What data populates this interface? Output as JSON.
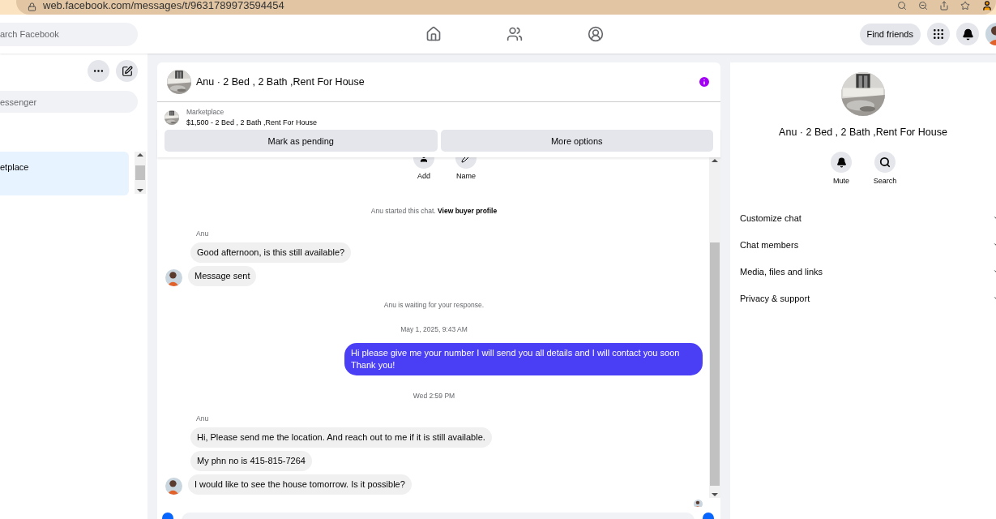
{
  "browser": {
    "url": "web.facebook.com/messages/t/9631789973594454"
  },
  "topbar": {
    "search_placeholder": "arch Facebook",
    "find_friends": "Find friends"
  },
  "sidebar": {
    "search_placeholder": "essenger",
    "items": [
      {
        "label": "etplace",
        "selected": true
      }
    ]
  },
  "chat": {
    "title": "Anu · 2 Bed , 2 Bath ,Rent For House",
    "listing": {
      "source": "Marketplace",
      "summary": "$1,500 - 2 Bed , 2 Bath ,Rent For House"
    },
    "actions": [
      "Mark as pending",
      "More options"
    ],
    "quick_actions": [
      "Add",
      "Name"
    ],
    "messages": [
      {
        "kind": "notice",
        "text": "Anu started this chat.",
        "link": "View buyer profile"
      },
      {
        "kind": "sender",
        "text": "Anu"
      },
      {
        "kind": "incoming",
        "text": "Good afternoon, is this still available?",
        "avatar": false
      },
      {
        "kind": "incoming",
        "text": "Message sent",
        "avatar": true
      },
      {
        "kind": "notice",
        "text": "Anu is waiting for your response."
      },
      {
        "kind": "time",
        "text": "May 1, 2025, 9:43 AM"
      },
      {
        "kind": "outgoing",
        "text": "Hi please give me your number I will send you all details and I will contact you soon Thank you!"
      },
      {
        "kind": "time",
        "text": "Wed 2:59 PM"
      },
      {
        "kind": "sender",
        "text": "Anu"
      },
      {
        "kind": "incoming",
        "text": "Hi, Please send me the location. And reach out to me if it is still available.",
        "avatar": false
      },
      {
        "kind": "incoming",
        "text": "My phn no is 415-815-7264",
        "avatar": false
      },
      {
        "kind": "incoming",
        "text": "I would like to see the house tomorrow. Is it possible?",
        "avatar": true
      },
      {
        "kind": "seen"
      }
    ]
  },
  "details": {
    "title": "Anu · 2 Bed , 2 Bath ,Rent For House",
    "actions": [
      "Mute",
      "Search"
    ],
    "sections": [
      "Customize chat",
      "Chat members",
      "Media, files and links",
      "Privacy & support"
    ]
  }
}
